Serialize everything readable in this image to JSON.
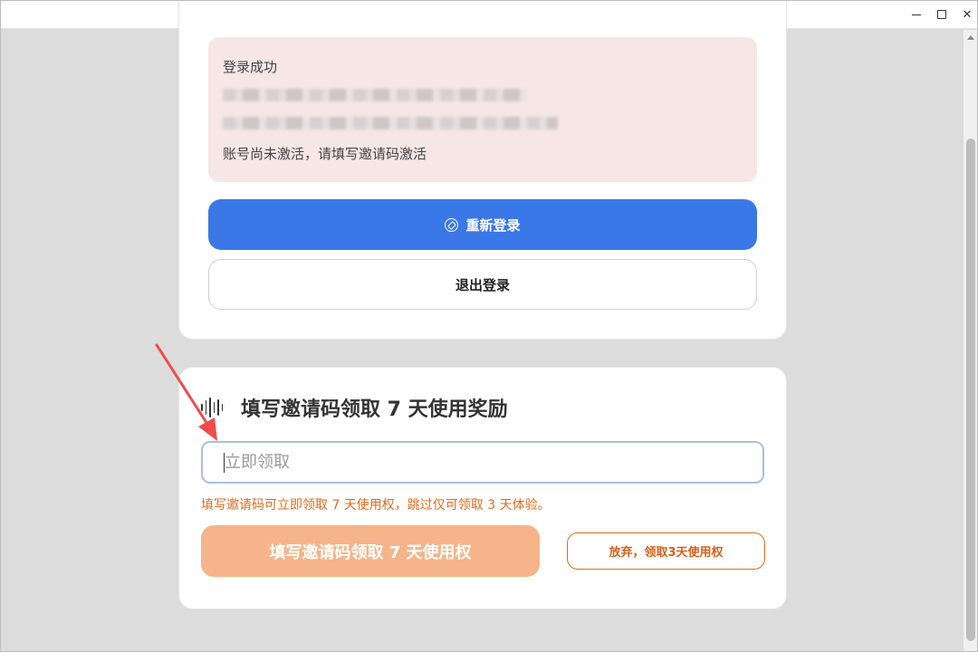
{
  "window": {
    "controls": {
      "minimize": "minimize",
      "maximize": "maximize",
      "close": "✕"
    }
  },
  "login_card": {
    "notice_title": "登录成功",
    "notice_message": "账号尚未激活，请填写邀请码激活",
    "relogin_label": "重新登录",
    "logout_label": "退出登录"
  },
  "invite_card": {
    "title": "填写邀请码领取 7 天使用奖励",
    "input_placeholder": "立即领取",
    "input_value": "",
    "hint": "填写邀请码可立即领取 7 天使用权，跳过仅可领取 3 天体验。",
    "claim_label": "填写邀请码领取 7 天使用权",
    "skip_label": "放弃，领取3天使用权"
  },
  "colors": {
    "primary": "#3b78e7",
    "accent": "#e26a1b",
    "claim_disabled": "#f5b48a",
    "notice_bg": "#f6e6e6",
    "annotation_arrow": "#ef4b4b"
  },
  "icons": {
    "relogin": "compass-icon",
    "section": "waveform-icon",
    "annotation": "red-arrow-icon"
  }
}
